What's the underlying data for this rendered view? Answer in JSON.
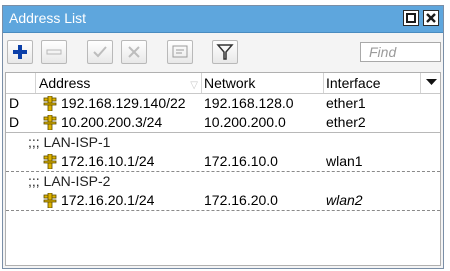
{
  "window": {
    "title": "Address List"
  },
  "toolbar": {
    "buttons": [
      "add",
      "remove",
      "enable",
      "disable",
      "comment",
      "filter"
    ],
    "find_placeholder": "Find"
  },
  "table": {
    "columns": [
      "Address",
      "Network",
      "Interface"
    ],
    "rows": [
      {
        "flag": "D",
        "address": "192.168.129.140/22",
        "network": "192.168.128.0",
        "interface": "ether1"
      },
      {
        "flag": "D",
        "address": "10.200.200.3/24",
        "network": "10.200.200.0",
        "interface": "ether2"
      },
      {
        "comment": ";;; LAN-ISP-1"
      },
      {
        "flag": "",
        "address": "172.16.10.1/24",
        "network": "172.16.10.0",
        "interface": "wlan1"
      },
      {
        "comment": ";;; LAN-ISP-2"
      },
      {
        "flag": "",
        "address": "172.16.20.1/24",
        "network": "172.16.20.0",
        "interface": "wlan2"
      }
    ]
  },
  "colors": {
    "titlebar": "#5ea6dd",
    "add_icon": "#0b3fa8",
    "address_icon": "#e0b400"
  }
}
